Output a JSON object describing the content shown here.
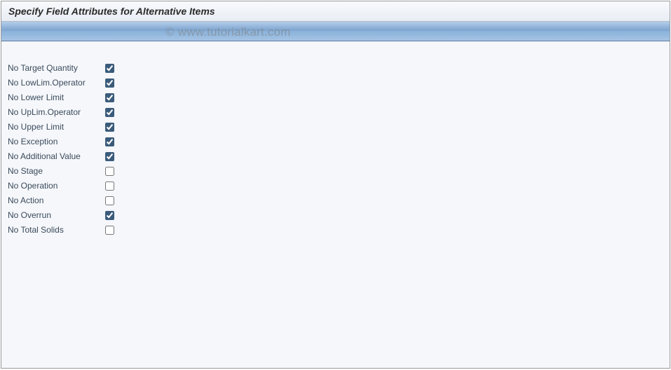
{
  "title": "Specify Field Attributes for Alternative Items",
  "watermark": "© www.tutorialkart.com",
  "fields": [
    {
      "label": "No Target Quantity",
      "checked": true
    },
    {
      "label": "No LowLim.Operator",
      "checked": true
    },
    {
      "label": "No Lower Limit",
      "checked": true
    },
    {
      "label": "No UpLim.Operator",
      "checked": true
    },
    {
      "label": "No Upper Limit",
      "checked": true
    },
    {
      "label": "No Exception",
      "checked": true
    },
    {
      "label": "No Additional Value",
      "checked": true
    },
    {
      "label": "No Stage",
      "checked": false
    },
    {
      "label": "No Operation",
      "checked": false
    },
    {
      "label": "No Action",
      "checked": false
    },
    {
      "label": "No Overrun",
      "checked": true
    },
    {
      "label": "No Total Solids",
      "checked": false
    }
  ]
}
